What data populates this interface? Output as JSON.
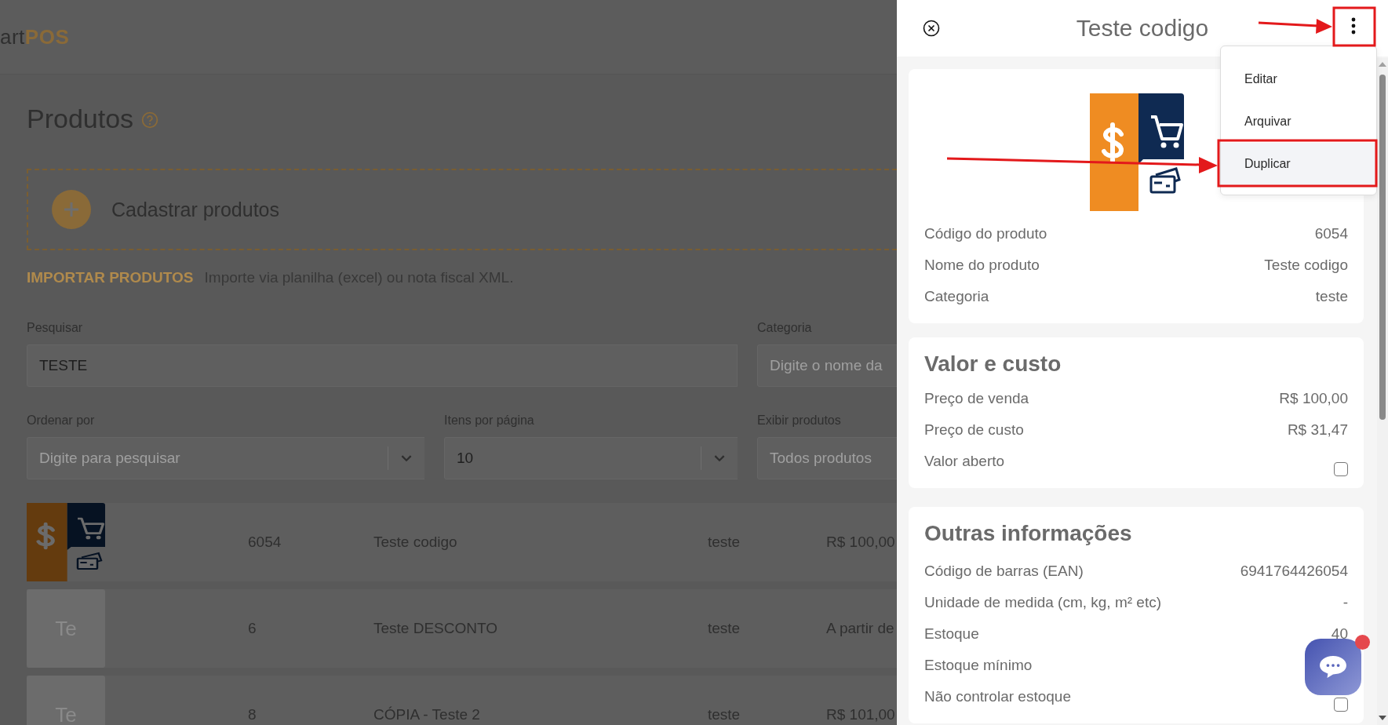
{
  "header": {
    "logo": {
      "prefix": "art",
      "brand": "POS"
    }
  },
  "page": {
    "title": "Produtos",
    "register_label": "Cadastrar produtos",
    "import_link": "IMPORTAR PRODUTOS",
    "import_text": "Importe via planilha (excel) ou nota fiscal XML."
  },
  "filter_rows": [
    [
      {
        "label": "Pesquisar",
        "value": "TESTE",
        "kind": "text"
      },
      {
        "label": "Categoria",
        "placeholder": "Digite o nome da",
        "kind": "text"
      }
    ],
    [
      {
        "label": "Ordenar por",
        "placeholder": "Digite para pesquisar",
        "kind": "select"
      },
      {
        "label": "Itens por página",
        "value": "10",
        "kind": "select"
      },
      {
        "label": "Exibir produtos",
        "placeholder": "Todos produtos",
        "kind": "text"
      }
    ]
  ],
  "products": [
    {
      "code": "6054",
      "name": "Teste codigo",
      "category": "teste",
      "price": "R$ 100,00"
    },
    {
      "thumb": {
        "kind": "initials",
        "text": "Te"
      },
      "code": "6",
      "name": "Teste DESCONTO",
      "category": "teste",
      "price": "A partir de"
    },
    {
      "thumb": {
        "kind": "initials",
        "text": "Te"
      },
      "code": "8",
      "name": "CÓPIA - Teste 2",
      "category": "teste",
      "price": "R$ 101,00"
    }
  ],
  "panel": {
    "title": "Teste codigo",
    "menu": [
      {
        "label": "Editar",
        "selected": false
      },
      {
        "label": "Arquivar",
        "selected": false
      },
      {
        "label": "Duplicar",
        "selected": true
      }
    ],
    "sections": [
      {
        "rows": [
          {
            "label": "Código do produto",
            "value": "6054",
            "kind": "text"
          },
          {
            "label": "Nome do produto",
            "value": "Teste codigo",
            "kind": "text"
          },
          {
            "label": "Categoria",
            "value": "teste",
            "kind": "text"
          }
        ]
      },
      {
        "title": "Valor e custo",
        "rows": [
          {
            "label": "Preço de venda",
            "value": "R$ 100,00",
            "kind": "text"
          },
          {
            "label": "Preço de custo",
            "value": "R$ 31,47",
            "kind": "text"
          },
          {
            "label": "Valor aberto",
            "kind": "checkbox",
            "checked": false
          }
        ]
      },
      {
        "title": "Outras informações",
        "rows": [
          {
            "label": "Código de barras (EAN)",
            "value": "6941764426054",
            "kind": "text"
          },
          {
            "label": "Unidade de medida (cm, kg, m² etc)",
            "value": "-",
            "kind": "text"
          },
          {
            "label": "Estoque",
            "value": "40",
            "kind": "text"
          },
          {
            "label": "Estoque mínimo",
            "kind": "hidden"
          },
          {
            "label": "Não controlar estoque",
            "kind": "checkbox",
            "checked": false
          }
        ]
      }
    ]
  }
}
